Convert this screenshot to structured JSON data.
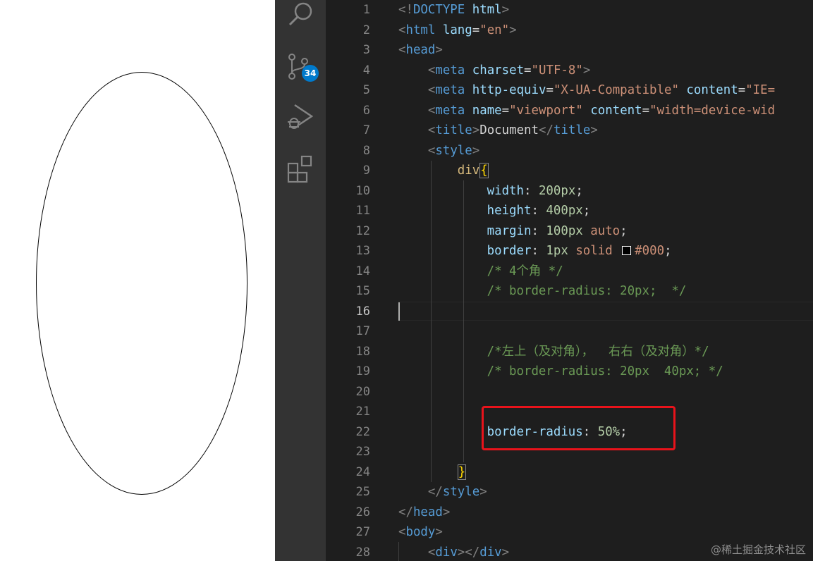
{
  "activity_bar": {
    "icons": [
      "search-icon",
      "source-control-icon",
      "run-debug-icon",
      "extensions-icon"
    ],
    "source_control_badge": "34"
  },
  "editor": {
    "active_line": 16,
    "lines": [
      {
        "n": "1",
        "tokens": [
          {
            "t": "<!",
            "c": "punc"
          },
          {
            "t": "DOCTYPE",
            "c": "tag"
          },
          {
            "t": " ",
            "c": "text"
          },
          {
            "t": "html",
            "c": "attr"
          },
          {
            "t": ">",
            "c": "punc"
          }
        ]
      },
      {
        "n": "2",
        "tokens": [
          {
            "t": "<",
            "c": "punc"
          },
          {
            "t": "html",
            "c": "tag"
          },
          {
            "t": " ",
            "c": "text"
          },
          {
            "t": "lang",
            "c": "attr"
          },
          {
            "t": "=",
            "c": "text"
          },
          {
            "t": "\"en\"",
            "c": "str"
          },
          {
            "t": ">",
            "c": "punc"
          }
        ]
      },
      {
        "n": "3",
        "tokens": [
          {
            "t": "<",
            "c": "punc"
          },
          {
            "t": "head",
            "c": "tag"
          },
          {
            "t": ">",
            "c": "punc"
          }
        ]
      },
      {
        "n": "4",
        "tokens": [
          {
            "t": "    ",
            "c": "text"
          },
          {
            "t": "<",
            "c": "punc"
          },
          {
            "t": "meta",
            "c": "tag"
          },
          {
            "t": " ",
            "c": "text"
          },
          {
            "t": "charset",
            "c": "attr"
          },
          {
            "t": "=",
            "c": "text"
          },
          {
            "t": "\"UTF-8\"",
            "c": "str"
          },
          {
            "t": ">",
            "c": "punc"
          }
        ]
      },
      {
        "n": "5",
        "tokens": [
          {
            "t": "    ",
            "c": "text"
          },
          {
            "t": "<",
            "c": "punc"
          },
          {
            "t": "meta",
            "c": "tag"
          },
          {
            "t": " ",
            "c": "text"
          },
          {
            "t": "http-equiv",
            "c": "attr"
          },
          {
            "t": "=",
            "c": "text"
          },
          {
            "t": "\"X-UA-Compatible\"",
            "c": "str"
          },
          {
            "t": " ",
            "c": "text"
          },
          {
            "t": "content",
            "c": "attr"
          },
          {
            "t": "=",
            "c": "text"
          },
          {
            "t": "\"IE=",
            "c": "str"
          }
        ]
      },
      {
        "n": "6",
        "tokens": [
          {
            "t": "    ",
            "c": "text"
          },
          {
            "t": "<",
            "c": "punc"
          },
          {
            "t": "meta",
            "c": "tag"
          },
          {
            "t": " ",
            "c": "text"
          },
          {
            "t": "name",
            "c": "attr"
          },
          {
            "t": "=",
            "c": "text"
          },
          {
            "t": "\"viewport\"",
            "c": "str"
          },
          {
            "t": " ",
            "c": "text"
          },
          {
            "t": "content",
            "c": "attr"
          },
          {
            "t": "=",
            "c": "text"
          },
          {
            "t": "\"width=device-wid",
            "c": "str"
          }
        ]
      },
      {
        "n": "7",
        "tokens": [
          {
            "t": "    ",
            "c": "text"
          },
          {
            "t": "<",
            "c": "punc"
          },
          {
            "t": "title",
            "c": "tag"
          },
          {
            "t": ">",
            "c": "punc"
          },
          {
            "t": "Document",
            "c": "text"
          },
          {
            "t": "</",
            "c": "punc"
          },
          {
            "t": "title",
            "c": "tag"
          },
          {
            "t": ">",
            "c": "punc"
          }
        ]
      },
      {
        "n": "8",
        "tokens": [
          {
            "t": "    ",
            "c": "text"
          },
          {
            "t": "<",
            "c": "punc"
          },
          {
            "t": "style",
            "c": "tag"
          },
          {
            "t": ">",
            "c": "punc"
          }
        ]
      },
      {
        "n": "9",
        "tokens": [
          {
            "t": "        ",
            "c": "text"
          },
          {
            "t": "div",
            "c": "sel"
          },
          {
            "t": "{",
            "c": "brace",
            "box": true
          }
        ]
      },
      {
        "n": "10",
        "tokens": [
          {
            "t": "            ",
            "c": "text"
          },
          {
            "t": "width",
            "c": "prop"
          },
          {
            "t": ": ",
            "c": "text"
          },
          {
            "t": "200px",
            "c": "num"
          },
          {
            "t": ";",
            "c": "text"
          }
        ]
      },
      {
        "n": "11",
        "tokens": [
          {
            "t": "            ",
            "c": "text"
          },
          {
            "t": "height",
            "c": "prop"
          },
          {
            "t": ": ",
            "c": "text"
          },
          {
            "t": "400px",
            "c": "num"
          },
          {
            "t": ";",
            "c": "text"
          }
        ]
      },
      {
        "n": "12",
        "tokens": [
          {
            "t": "            ",
            "c": "text"
          },
          {
            "t": "margin",
            "c": "prop"
          },
          {
            "t": ": ",
            "c": "text"
          },
          {
            "t": "100px",
            "c": "num"
          },
          {
            "t": " ",
            "c": "text"
          },
          {
            "t": "auto",
            "c": "val"
          },
          {
            "t": ";",
            "c": "text"
          }
        ]
      },
      {
        "n": "13",
        "tokens": [
          {
            "t": "            ",
            "c": "text"
          },
          {
            "t": "border",
            "c": "prop"
          },
          {
            "t": ": ",
            "c": "text"
          },
          {
            "t": "1px",
            "c": "num"
          },
          {
            "t": " ",
            "c": "text"
          },
          {
            "t": "solid",
            "c": "val"
          },
          {
            "t": " ",
            "c": "text",
            "swatch": "#000000"
          },
          {
            "t": "#000",
            "c": "val"
          },
          {
            "t": ";",
            "c": "text"
          }
        ]
      },
      {
        "n": "14",
        "tokens": [
          {
            "t": "            ",
            "c": "text"
          },
          {
            "t": "/* 4个角 */",
            "c": "com"
          }
        ]
      },
      {
        "n": "15",
        "tokens": [
          {
            "t": "            ",
            "c": "text"
          },
          {
            "t": "/* border-radius: 20px;  */",
            "c": "com"
          }
        ]
      },
      {
        "n": "16",
        "tokens": []
      },
      {
        "n": "17",
        "tokens": []
      },
      {
        "n": "18",
        "tokens": [
          {
            "t": "            ",
            "c": "text"
          },
          {
            "t": "/*左上（及对角），  右右（及对角）*/",
            "c": "com"
          }
        ]
      },
      {
        "n": "19",
        "tokens": [
          {
            "t": "            ",
            "c": "text"
          },
          {
            "t": "/* border-radius: 20px  40px; */",
            "c": "com"
          }
        ]
      },
      {
        "n": "20",
        "tokens": []
      },
      {
        "n": "21",
        "tokens": []
      },
      {
        "n": "22",
        "tokens": [
          {
            "t": "            ",
            "c": "text"
          },
          {
            "t": "border-radius",
            "c": "prop"
          },
          {
            "t": ": ",
            "c": "text"
          },
          {
            "t": "50%",
            "c": "num"
          },
          {
            "t": ";",
            "c": "text"
          }
        ]
      },
      {
        "n": "23",
        "tokens": []
      },
      {
        "n": "24",
        "tokens": [
          {
            "t": "        ",
            "c": "text"
          },
          {
            "t": "}",
            "c": "brace",
            "box": true
          }
        ]
      },
      {
        "n": "25",
        "tokens": [
          {
            "t": "    ",
            "c": "text"
          },
          {
            "t": "</",
            "c": "punc"
          },
          {
            "t": "style",
            "c": "tag"
          },
          {
            "t": ">",
            "c": "punc"
          }
        ]
      },
      {
        "n": "26",
        "tokens": [
          {
            "t": "</",
            "c": "punc"
          },
          {
            "t": "head",
            "c": "tag"
          },
          {
            "t": ">",
            "c": "punc"
          }
        ]
      },
      {
        "n": "27",
        "tokens": [
          {
            "t": "<",
            "c": "punc"
          },
          {
            "t": "body",
            "c": "tag"
          },
          {
            "t": ">",
            "c": "punc"
          }
        ]
      },
      {
        "n": "28",
        "tokens": [
          {
            "t": "    ",
            "c": "text"
          },
          {
            "t": "<",
            "c": "punc"
          },
          {
            "t": "div",
            "c": "tag"
          },
          {
            "t": "></",
            "c": "punc"
          },
          {
            "t": "div",
            "c": "tag"
          },
          {
            "t": ">",
            "c": "punc"
          }
        ]
      }
    ]
  },
  "watermark": "@稀土掘金技术社区",
  "colors": {
    "editor_bg": "#1e1e1e",
    "activity_bg": "#333333",
    "badge": "#007acc",
    "highlight_box": "#e8131b"
  }
}
